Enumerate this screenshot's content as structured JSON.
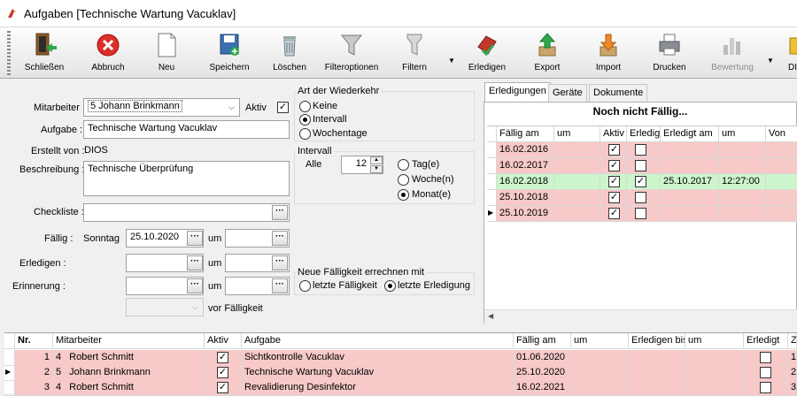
{
  "window": {
    "title": "Aufgaben [Technische Wartung Vacuklav]"
  },
  "toolbar": {
    "buttons": [
      {
        "label": "Schließen",
        "icon": "exit-icon"
      },
      {
        "label": "Abbruch",
        "icon": "cancel-icon"
      },
      {
        "label": "Neu",
        "icon": "new-icon"
      },
      {
        "label": "Speichern",
        "icon": "save-icon"
      },
      {
        "label": "Löschen",
        "icon": "delete-icon"
      },
      {
        "label": "Filteroptionen",
        "icon": "filter-options-icon"
      },
      {
        "label": "Filtern",
        "icon": "filter-icon"
      },
      {
        "label": "Erledigen",
        "icon": "complete-icon"
      },
      {
        "label": "Export",
        "icon": "export-icon"
      },
      {
        "label": "Import",
        "icon": "import-icon"
      },
      {
        "label": "Drucken",
        "icon": "print-icon"
      },
      {
        "label": "Bewertung",
        "icon": "rating-icon"
      },
      {
        "label": "DI",
        "icon": "di-icon"
      }
    ]
  },
  "form": {
    "mitarbeiter_label": "Mitarbeiter :",
    "mitarbeiter_value": "5   Johann Brinkmann",
    "aktiv_label": "Aktiv",
    "aktiv_checked": "✓",
    "aufgabe_label": "Aufgabe :",
    "aufgabe_value": "Technische Wartung Vacuklav",
    "erstellt_label": "Erstellt von :",
    "erstellt_value": "DIOS",
    "beschreibung_label": "Beschreibung :",
    "beschreibung_value": "Technische Überprüfung",
    "checkliste_label": "Checkliste :",
    "faellig_label": "Fällig :",
    "faellig_day": "Sonntag",
    "faellig_date": "25.10.2020",
    "um_label": "um",
    "erledigen_label": "Erledigen :",
    "erinnerung_label": "Erinnerung :",
    "vor_faelligkeit": "vor Fälligkeit",
    "dots": "···"
  },
  "wiederkehr": {
    "title": "Art der Wiederkehr",
    "options": [
      "Keine",
      "Intervall",
      "Wochentage"
    ],
    "selected": "Intervall"
  },
  "intervall": {
    "title": "Intervall",
    "alle_label": "Alle",
    "value": "12",
    "units": [
      "Tag(e)",
      "Woche(n)",
      "Monat(e)"
    ],
    "selected": "Monat(e)"
  },
  "neue_faelligkeit": {
    "title": "Neue Fälligkeit errechnen mit",
    "options": [
      "letzte Fälligkeit",
      "letzte Erledigung"
    ],
    "selected": "letzte Erledigung"
  },
  "tabs": [
    "Erledigungen",
    "Geräte",
    "Dokumente"
  ],
  "erledigungen": {
    "header": "Noch nicht Fällig...",
    "columns": [
      "Fällig am",
      "um",
      "Aktiv",
      "Erledigt",
      "Erledigt am",
      "um",
      "Von"
    ],
    "rows": [
      {
        "faellig": "16.02.2016",
        "um": "",
        "aktiv": "✓",
        "erledigt": "",
        "erledigt_am": "",
        "um2": "",
        "von": "",
        "color": "#f7c9c9"
      },
      {
        "faellig": "16.02.2017",
        "um": "",
        "aktiv": "✓",
        "erledigt": "",
        "erledigt_am": "",
        "um2": "",
        "von": "",
        "color": "#f7c9c9"
      },
      {
        "faellig": "16.02.2018",
        "um": "",
        "aktiv": "✓",
        "erledigt": "✓",
        "erledigt_am": "25.10.2017",
        "um2": "12:27:00",
        "von": "",
        "color": "#ccf5cc"
      },
      {
        "faellig": "25.10.2018",
        "um": "",
        "aktiv": "✓",
        "erledigt": "",
        "erledigt_am": "",
        "um2": "",
        "von": "",
        "color": "#f7c9c9"
      },
      {
        "faellig": "25.10.2019",
        "um": "",
        "aktiv": "✓",
        "erledigt": "",
        "erledigt_am": "",
        "um2": "",
        "von": "",
        "color": "#f7c9c9"
      }
    ]
  },
  "aufgaben": {
    "columns": [
      "Nr.",
      "Mitarbeiter",
      "Aktiv",
      "Aufgabe",
      "Fällig am",
      "um",
      "Erledigen bis",
      "um",
      "Erledigt",
      "Z"
    ],
    "rows": [
      {
        "nr": "1",
        "ma_nr": "4",
        "mitarbeiter": "Robert Schmitt",
        "aktiv": "✓",
        "aufgabe": "Sichtkontrolle Vacuklav",
        "faellig": "01.06.2020",
        "z": "1"
      },
      {
        "nr": "2",
        "ma_nr": "5",
        "mitarbeiter": "Johann Brinkmann",
        "aktiv": "✓",
        "aufgabe": "Technische Wartung Vacuklav",
        "faellig": "25.10.2020",
        "z": "2"
      },
      {
        "nr": "3",
        "ma_nr": "4",
        "mitarbeiter": "Robert Schmitt",
        "aktiv": "✓",
        "aufgabe": "Revalidierung Desinfektor",
        "faellig": "16.02.2021",
        "z": "3"
      }
    ]
  }
}
